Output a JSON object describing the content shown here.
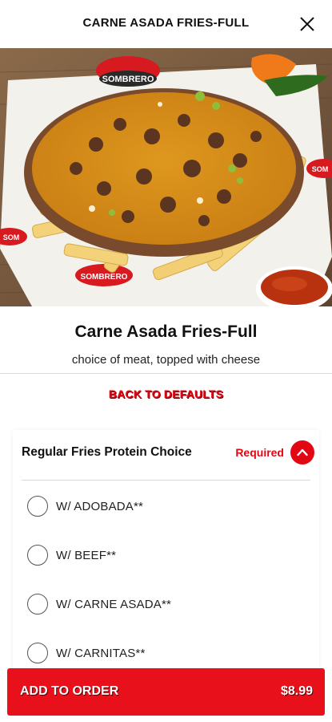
{
  "header": {
    "title": "CARNE ASADA FRIES-FULL",
    "close_icon": "close-icon"
  },
  "hero": {
    "image": "carne asada fries photo",
    "brand_text": "SOMBRERO"
  },
  "item": {
    "name": "Carne Asada Fries-Full",
    "description": "choice of meat, topped with cheese"
  },
  "back_to_defaults": "BACK TO DEFAULTS",
  "modifier_group": {
    "title": "Regular Fries Protein Choice",
    "required_label": "Required",
    "toggle_icon": "chevron-up-icon",
    "options": [
      {
        "label": "W/ ADOBADA**"
      },
      {
        "label": "W/ BEEF**"
      },
      {
        "label": "W/ CARNE ASADA**"
      },
      {
        "label": "W/ CARNITAS**"
      }
    ]
  },
  "footer": {
    "add_label": "ADD TO ORDER",
    "price": "$8.99"
  },
  "colors": {
    "accent": "#e8101b",
    "text": "#111111"
  }
}
